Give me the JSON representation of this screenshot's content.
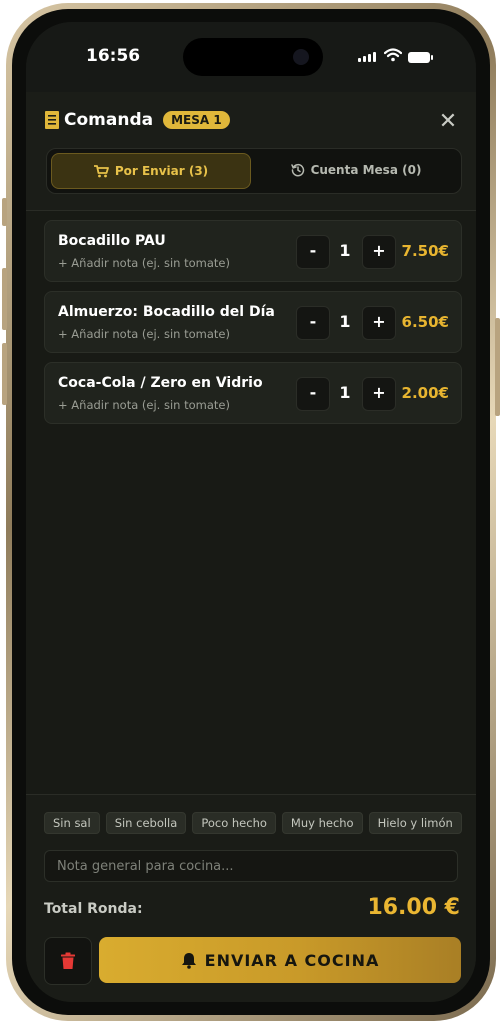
{
  "status_bar": {
    "time": "16:56"
  },
  "header": {
    "title": "Comanda",
    "table_badge": "MESA 1",
    "close_label": "✕",
    "tabs": [
      {
        "label": "Por Enviar (3)",
        "active": true
      },
      {
        "label": "Cuenta Mesa (0)",
        "active": false
      }
    ]
  },
  "items": [
    {
      "name": "Bocadillo PAU",
      "note_placeholder": "+ Añadir nota (ej. sin tomate)",
      "minus": "-",
      "qty": "1",
      "plus": "+",
      "price": "7.50€"
    },
    {
      "name": "Almuerzo: Bocadillo del Día",
      "note_placeholder": "+ Añadir nota (ej. sin tomate)",
      "minus": "-",
      "qty": "1",
      "plus": "+",
      "price": "6.50€"
    },
    {
      "name": "Coca-Cola / Zero en Vidrio",
      "note_placeholder": "+ Añadir nota (ej. sin tomate)",
      "minus": "-",
      "qty": "1",
      "plus": "+",
      "price": "2.00€"
    }
  ],
  "footer": {
    "chips": [
      "Sin sal",
      "Sin cebolla",
      "Poco hecho",
      "Muy hecho",
      "Hielo y limón"
    ],
    "kitchen_note_placeholder": "Nota general para cocina...",
    "total_label": "Total Ronda:",
    "total_value": "16.00 €",
    "send_label": "ENVIAR A COCINA"
  },
  "colors": {
    "accent": "#e8b530",
    "background": "#181a15",
    "danger": "#e53935"
  },
  "icons": [
    "receipt-icon",
    "close-icon",
    "cart-icon",
    "history-icon",
    "trash-icon",
    "bell-icon"
  ]
}
